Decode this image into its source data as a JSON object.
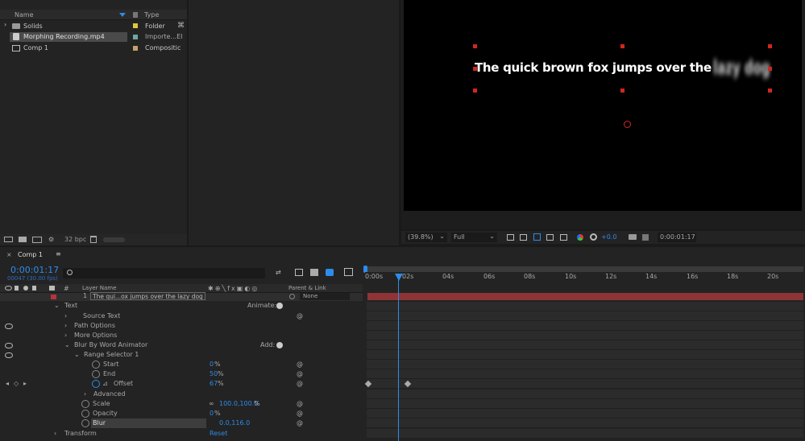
{
  "project": {
    "col_name": "Name",
    "col_type": "Type",
    "items": [
      {
        "name": "Solids",
        "type": "Folder",
        "color": "#e0c63c"
      },
      {
        "name": "Morphing Recording.mp4",
        "type": "Importe...EI",
        "color": "#6fa6a6"
      },
      {
        "name": "Comp 1",
        "type": "Compositic",
        "color": "#c2a26c"
      }
    ],
    "bpc": "32 bpc"
  },
  "viewer": {
    "text": "The quick brown fox jumps over the",
    "blur_text": "lazy dog",
    "zoom": "(39.8%)",
    "resolution": "Full",
    "exposure": "+0.0",
    "timecode": "0:00:01:17"
  },
  "timeline": {
    "tab": "Comp 1",
    "timecode": "0:00:01:17",
    "frames": "00047 (30.00 fps)",
    "col_num": "#",
    "col_layer": "Layer Name",
    "col_parent": "Parent & Link",
    "layer_number": "1",
    "layer_name": "The qui...ox jumps over the lazy dog",
    "parent_value": "None",
    "ruler": [
      "0:00s",
      "02s",
      "04s",
      "06s",
      "08s",
      "10s",
      "12s",
      "14s",
      "16s",
      "18s",
      "20s"
    ],
    "props": {
      "text": "Text",
      "animate": "Animate:",
      "source_text": "Source Text",
      "path_options": "Path Options",
      "more_options": "More Options",
      "animator": "Blur By Word Animator",
      "add": "Add:",
      "range_selector": "Range Selector 1",
      "start": "Start",
      "start_val": "0",
      "end": "End",
      "end_val": "50",
      "offset": "Offset",
      "offset_val": "67",
      "advanced": "Advanced",
      "scale": "Scale",
      "scale_val": "100.0,100.0",
      "opacity": "Opacity",
      "opacity_val": "0",
      "blur": "Blur",
      "blur_val": "0.0,116.0",
      "transform": "Transform",
      "reset": "Reset",
      "pct": "%"
    }
  }
}
